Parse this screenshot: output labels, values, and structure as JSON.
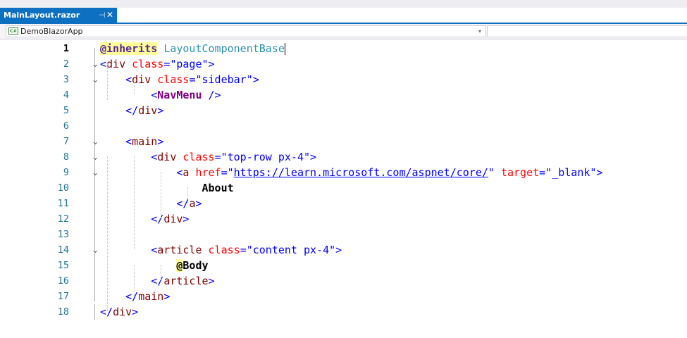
{
  "tab": {
    "title": "MainLayout.razor",
    "pin_icon": "pin-icon",
    "close_icon": "close-icon",
    "pin_glyph": "⊣",
    "close_glyph": "✕"
  },
  "navbar": {
    "project": "DemoBlazorApp",
    "project_icon": "csharp-project-icon",
    "dropdown_icon": "chevron-down-icon"
  },
  "colors": {
    "tab_active": "#0e70c0",
    "line_number": "#237893",
    "tag": "#800000",
    "attribute": "#ff0000",
    "string": "#0000ff",
    "component": "#7f007f"
  },
  "editor": {
    "current_line": 1,
    "lines": [
      {
        "n": "1",
        "tokens": [
          {
            "c": "k-dir",
            "t": "@inherits"
          },
          {
            "c": "",
            "t": " "
          },
          {
            "c": "k-type",
            "t": "LayoutComponentBase"
          }
        ]
      },
      {
        "n": "2",
        "tokens": [
          {
            "c": "k-punc",
            "t": "<"
          },
          {
            "c": "k-tag",
            "t": "div"
          },
          {
            "c": "",
            "t": " "
          },
          {
            "c": "k-attr",
            "t": "class"
          },
          {
            "c": "k-punc",
            "t": "="
          },
          {
            "c": "k-str",
            "t": "\"page\""
          },
          {
            "c": "k-punc",
            "t": ">"
          }
        ]
      },
      {
        "n": "3",
        "tokens": [
          {
            "c": "",
            "t": "    "
          },
          {
            "c": "k-punc",
            "t": "<"
          },
          {
            "c": "k-tag",
            "t": "div"
          },
          {
            "c": "",
            "t": " "
          },
          {
            "c": "k-attr",
            "t": "class"
          },
          {
            "c": "k-punc",
            "t": "="
          },
          {
            "c": "k-str",
            "t": "\"sidebar\""
          },
          {
            "c": "k-punc",
            "t": ">"
          }
        ]
      },
      {
        "n": "4",
        "tokens": [
          {
            "c": "",
            "t": "        "
          },
          {
            "c": "k-punc",
            "t": "<"
          },
          {
            "c": "k-comp",
            "t": "NavMenu"
          },
          {
            "c": "",
            "t": " "
          },
          {
            "c": "k-punc",
            "t": "/>"
          }
        ]
      },
      {
        "n": "5",
        "tokens": [
          {
            "c": "",
            "t": "    "
          },
          {
            "c": "k-punc",
            "t": "</"
          },
          {
            "c": "k-tag",
            "t": "div"
          },
          {
            "c": "k-punc",
            "t": ">"
          }
        ]
      },
      {
        "n": "6",
        "tokens": []
      },
      {
        "n": "7",
        "tokens": [
          {
            "c": "",
            "t": "    "
          },
          {
            "c": "k-punc",
            "t": "<"
          },
          {
            "c": "k-tag",
            "t": "main"
          },
          {
            "c": "k-punc",
            "t": ">"
          }
        ]
      },
      {
        "n": "8",
        "tokens": [
          {
            "c": "",
            "t": "        "
          },
          {
            "c": "k-punc",
            "t": "<"
          },
          {
            "c": "k-tag",
            "t": "div"
          },
          {
            "c": "",
            "t": " "
          },
          {
            "c": "k-attr",
            "t": "class"
          },
          {
            "c": "k-punc",
            "t": "="
          },
          {
            "c": "k-str",
            "t": "\"top-row px-4\""
          },
          {
            "c": "k-punc",
            "t": ">"
          }
        ]
      },
      {
        "n": "9",
        "tokens": [
          {
            "c": "",
            "t": "            "
          },
          {
            "c": "k-punc",
            "t": "<"
          },
          {
            "c": "k-tag",
            "t": "a"
          },
          {
            "c": "",
            "t": " "
          },
          {
            "c": "k-attr",
            "t": "href"
          },
          {
            "c": "k-punc",
            "t": "="
          },
          {
            "c": "k-str",
            "t": "\""
          },
          {
            "c": "k-url",
            "t": "https://learn.microsoft.com/aspnet/core/"
          },
          {
            "c": "k-str",
            "t": "\""
          },
          {
            "c": "",
            "t": " "
          },
          {
            "c": "k-attr",
            "t": "target"
          },
          {
            "c": "k-punc",
            "t": "="
          },
          {
            "c": "k-str",
            "t": "\"_blank\""
          },
          {
            "c": "k-punc",
            "t": ">"
          }
        ]
      },
      {
        "n": "10",
        "tokens": [
          {
            "c": "",
            "t": "                "
          },
          {
            "c": "k-text",
            "t": "About"
          }
        ]
      },
      {
        "n": "11",
        "tokens": [
          {
            "c": "",
            "t": "            "
          },
          {
            "c": "k-punc",
            "t": "</"
          },
          {
            "c": "k-tag",
            "t": "a"
          },
          {
            "c": "k-punc",
            "t": ">"
          }
        ]
      },
      {
        "n": "12",
        "tokens": [
          {
            "c": "",
            "t": "        "
          },
          {
            "c": "k-punc",
            "t": "</"
          },
          {
            "c": "k-tag",
            "t": "div"
          },
          {
            "c": "k-punc",
            "t": ">"
          }
        ]
      },
      {
        "n": "13",
        "tokens": []
      },
      {
        "n": "14",
        "tokens": [
          {
            "c": "",
            "t": "        "
          },
          {
            "c": "k-punc",
            "t": "<"
          },
          {
            "c": "k-tag",
            "t": "article"
          },
          {
            "c": "",
            "t": " "
          },
          {
            "c": "k-attr",
            "t": "class"
          },
          {
            "c": "k-punc",
            "t": "="
          },
          {
            "c": "k-str",
            "t": "\"content px-4\""
          },
          {
            "c": "k-punc",
            "t": ">"
          }
        ]
      },
      {
        "n": "15",
        "tokens": [
          {
            "c": "",
            "t": "            "
          },
          {
            "c": "k-at",
            "t": "@"
          },
          {
            "c": "k-text",
            "t": "Body"
          }
        ]
      },
      {
        "n": "16",
        "tokens": [
          {
            "c": "",
            "t": "        "
          },
          {
            "c": "k-punc",
            "t": "</"
          },
          {
            "c": "k-tag",
            "t": "article"
          },
          {
            "c": "k-punc",
            "t": ">"
          }
        ]
      },
      {
        "n": "17",
        "tokens": [
          {
            "c": "",
            "t": "    "
          },
          {
            "c": "k-punc",
            "t": "</"
          },
          {
            "c": "k-tag",
            "t": "main"
          },
          {
            "c": "k-punc",
            "t": ">"
          }
        ]
      },
      {
        "n": "18",
        "tokens": [
          {
            "c": "k-punc",
            "t": "</"
          },
          {
            "c": "k-tag",
            "t": "div"
          },
          {
            "c": "k-punc",
            "t": ">"
          }
        ]
      }
    ],
    "fold_lines": [
      "2",
      "3",
      "7",
      "8",
      "9",
      "14"
    ],
    "fold_glyph": "⌄"
  }
}
